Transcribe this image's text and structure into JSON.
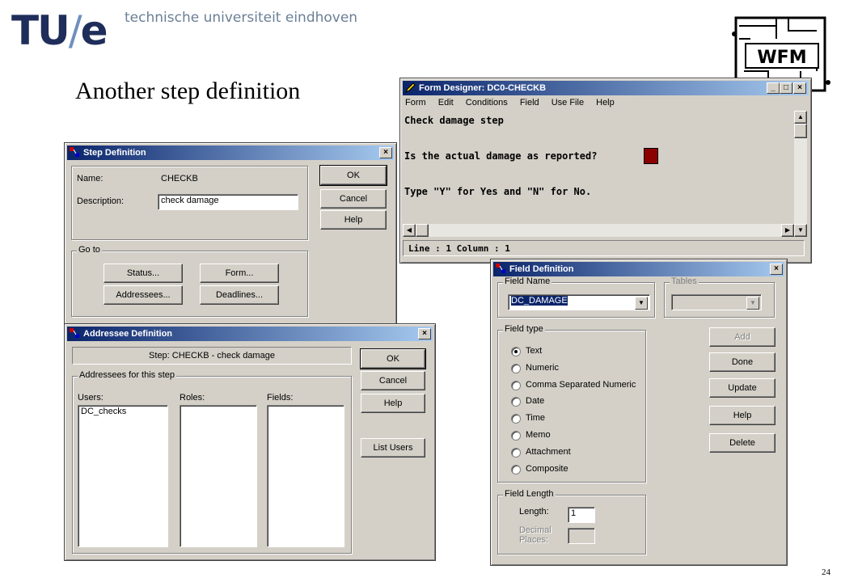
{
  "slide": {
    "logo_mark": "TU/e",
    "logo_text": "technische universiteit eindhoven",
    "title": "Another step definition",
    "page_number": "24",
    "corner_logo": "WFM"
  },
  "form_designer": {
    "title": "Form Designer: DC0-CHECKB",
    "menu": [
      "Form",
      "Edit",
      "Conditions",
      "Field",
      "Use File",
      "Help"
    ],
    "lines": [
      "Check damage step",
      "Is the actual damage as reported?",
      "Type \"Y\" for Yes and \"N\" for No."
    ],
    "status": "Line : 1  Column : 1",
    "field_color": "#8b0000"
  },
  "step_definition": {
    "title": "Step Definition",
    "name_label": "Name:",
    "name_value": "CHECKB",
    "desc_label": "Description:",
    "desc_value": "check damage",
    "ok": "OK",
    "cancel": "Cancel",
    "help": "Help",
    "goto_label": "Go to",
    "status_btn": "Status...",
    "form_btn": "Form...",
    "addressees_btn": "Addressees...",
    "deadlines_btn": "Deadlines..."
  },
  "addressee_definition": {
    "title": "Addressee Definition",
    "step_text": "Step:  CHECKB - check damage",
    "group_label": "Addressees for this step",
    "users_label": "Users:",
    "roles_label": "Roles:",
    "fields_label": "Fields:",
    "users": [
      "DC_checks"
    ],
    "ok": "OK",
    "cancel": "Cancel",
    "help": "Help",
    "list_users": "List Users"
  },
  "field_definition": {
    "title": "Field Definition",
    "field_name_label": "Field Name",
    "field_name_value": "DC_DAMAGE",
    "tables_label": "Tables",
    "field_type_label": "Field type",
    "types": [
      "Text",
      "Numeric",
      "Comma Separated Numeric",
      "Date",
      "Time",
      "Memo",
      "Attachment",
      "Composite"
    ],
    "selected_type": "Text",
    "add": "Add",
    "done": "Done",
    "update": "Update",
    "help": "Help",
    "delete": "Delete",
    "field_length_label": "Field Length",
    "length_label": "Length:",
    "length_value": "1",
    "decimal_label_1": "Decimal",
    "decimal_label_2": "Places:"
  }
}
